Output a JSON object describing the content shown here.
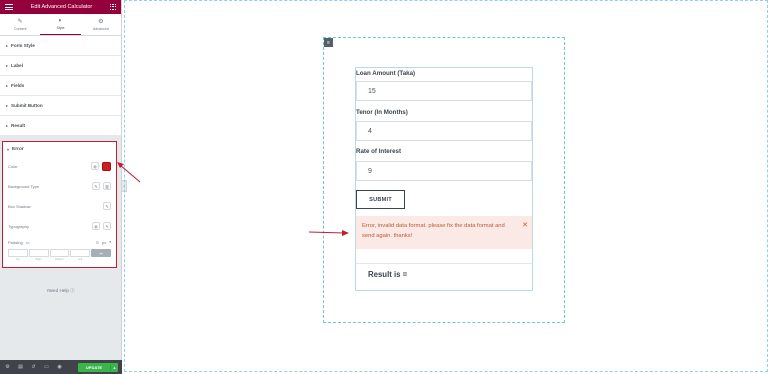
{
  "panel": {
    "title": "Edit Advanced Calculator",
    "tabs": [
      {
        "label": "Content",
        "icon": "pencil-icon"
      },
      {
        "label": "Style",
        "icon": "contrast-icon"
      },
      {
        "label": "Advanced",
        "icon": "gear-icon"
      }
    ],
    "sections": [
      "Form Style",
      "Label",
      "Fields",
      "Submit Button",
      "Result"
    ],
    "error_section": {
      "title": "Error",
      "controls": {
        "color": "Color",
        "color_value": "#cc1f1f",
        "background_type": "Background Type",
        "box_shadow": "Box Shadow",
        "typography": "Typography",
        "padding": "Padding",
        "padding_unit": "px"
      },
      "padding_labels": [
        "Top",
        "Right",
        "Bottom",
        "Left"
      ]
    },
    "need_help": "Need Help",
    "footer": {
      "update": "UPDATE"
    }
  },
  "form": {
    "fields": [
      {
        "label": "Loan Amount (Taka)",
        "value": "15"
      },
      {
        "label": "Tenor (In Months)",
        "value": "4"
      },
      {
        "label": "Rate of Interest",
        "value": "9"
      }
    ],
    "submit_label": "SUBMIT",
    "error_message": "Error, invalid data format. please fix the data format and send again. thanks!",
    "result_label": "Result is ="
  },
  "colors": {
    "brand": "#93003c",
    "error_border": "#c21d2e",
    "error_bg": "#fbe9e6",
    "update": "#39b54a"
  }
}
